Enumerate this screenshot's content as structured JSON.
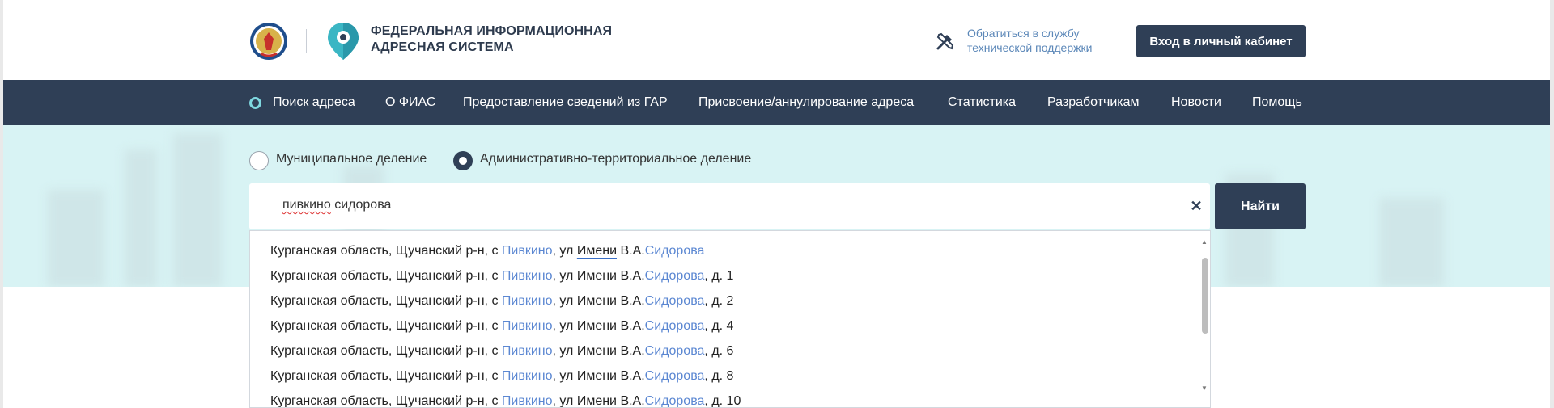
{
  "header": {
    "brand_line1": "ФЕДЕРАЛЬНАЯ ИНФОРМАЦИОННАЯ",
    "brand_line2": "АДРЕСНАЯ СИСТЕМА",
    "support_line1": "Обратиться в службу",
    "support_line2": "технической поддержки",
    "login_label": "Вход в личный кабинет"
  },
  "nav": {
    "items": [
      "Поиск адреса",
      "О ФИАС",
      "Предоставление сведений из ГАР",
      "Присвоение/аннулирование адреса",
      "Статистика",
      "Разработчикам",
      "Новости",
      "Помощь"
    ],
    "active_index": 0
  },
  "search": {
    "modes": [
      {
        "label": "Муниципальное деление",
        "selected": false
      },
      {
        "label": "Административно-территориальное деление",
        "selected": true
      }
    ],
    "query_word1": "пивкино",
    "query_word2": " сидорова",
    "find_label": "Найти"
  },
  "suggestions": [
    {
      "prefix": "Курганская область, Щучанский р-н, с ",
      "hl1": "Пивкино",
      "mid": ", ул ",
      "mid2": "Имени",
      "mid3": " В.А.",
      "hl2": "Сидорова",
      "suffix": ""
    },
    {
      "prefix": "Курганская область, Щучанский р-н, с ",
      "hl1": "Пивкино",
      "mid": ", ул Имени В.А.",
      "hl2": "Сидорова",
      "suffix": ", д. 1"
    },
    {
      "prefix": "Курганская область, Щучанский р-н, с ",
      "hl1": "Пивкино",
      "mid": ", ул Имени В.А.",
      "hl2": "Сидорова",
      "suffix": ", д. 2"
    },
    {
      "prefix": "Курганская область, Щучанский р-н, с ",
      "hl1": "Пивкино",
      "mid": ", ул Имени В.А.",
      "hl2": "Сидорова",
      "suffix": ", д. 4"
    },
    {
      "prefix": "Курганская область, Щучанский р-н, с ",
      "hl1": "Пивкино",
      "mid": ", ул Имени В.А.",
      "hl2": "Сидорова",
      "suffix": ", д. 6"
    },
    {
      "prefix": "Курганская область, Щучанский р-н, с ",
      "hl1": "Пивкино",
      "mid": ", ул Имени В.А.",
      "hl2": "Сидорова",
      "suffix": ", д. 8"
    },
    {
      "prefix": "Курганская область, Щучанский р-н, с ",
      "hl1": "Пивкино",
      "mid": ", ул Имени В.А.",
      "hl2": "Сидорова",
      "suffix": ", д. 10"
    }
  ],
  "colors": {
    "primary": "#2f3f56",
    "highlight": "#5b87d2",
    "band": "#d8f3f4",
    "active_dot": "#7fd8e0"
  }
}
